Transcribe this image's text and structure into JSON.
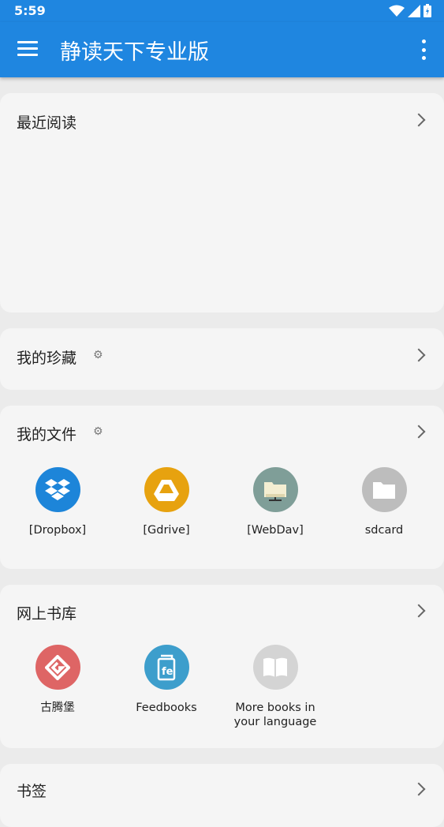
{
  "status": {
    "time": "5:59"
  },
  "app": {
    "title": "静读天下专业版"
  },
  "sections": {
    "recent": {
      "title": "最近阅读"
    },
    "favorites": {
      "title": "我的珍藏"
    },
    "files": {
      "title": "我的文件",
      "items": [
        {
          "label": "[Dropbox]",
          "icon": "dropbox-icon",
          "color": "#1d85d9"
        },
        {
          "label": "[Gdrive]",
          "icon": "google-drive-icon",
          "color": "#e7a20f"
        },
        {
          "label": "[WebDav]",
          "icon": "webdav-icon",
          "color": "#7f9e98"
        },
        {
          "label": "sdcard",
          "icon": "folder-icon",
          "color": "#bdbdbd"
        }
      ]
    },
    "library": {
      "title": "网上书库",
      "items": [
        {
          "label": "古腾堡",
          "icon": "gutenberg-icon",
          "color": "#de6565"
        },
        {
          "label": "Feedbooks",
          "icon": "feedbooks-icon",
          "color": "#3d9ecc"
        },
        {
          "label": "More books in your language",
          "icon": "book-icon",
          "color": "#d4d4d4"
        }
      ]
    },
    "bookmarks": {
      "title": "书签"
    }
  }
}
